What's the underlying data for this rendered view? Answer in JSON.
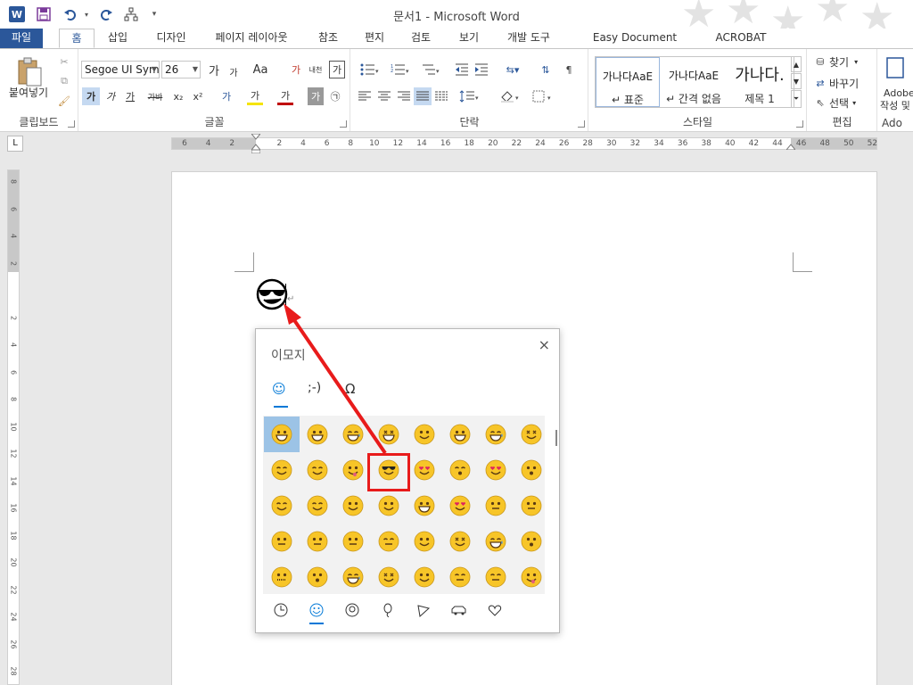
{
  "window": {
    "title": "문서1 - Microsoft Word",
    "app_icon": "W"
  },
  "quick_access": {
    "icons": [
      "save-icon",
      "undo-icon",
      "redo-icon",
      "tree-icon",
      "customize-icon"
    ]
  },
  "tabs": [
    {
      "label": "파일"
    },
    {
      "label": "홈"
    },
    {
      "label": "삽입"
    },
    {
      "label": "디자인"
    },
    {
      "label": "페이지 레이아웃"
    },
    {
      "label": "참조"
    },
    {
      "label": "편지"
    },
    {
      "label": "검토"
    },
    {
      "label": "보기"
    },
    {
      "label": "개발 도구"
    },
    {
      "label": "Easy Document Creator"
    },
    {
      "label": "ACROBAT"
    }
  ],
  "ribbon": {
    "clipboard": {
      "label": "클립보드",
      "paste_label": "붙여넣기"
    },
    "font": {
      "label": "글꼴",
      "font_name": "Segoe UI Sym",
      "font_size": "26",
      "row1": [
        "가",
        "가",
        "Aa",
        "가",
        "내천",
        "가"
      ],
      "row2": [
        "가",
        "가",
        "가",
        "가바",
        "x₂",
        "x²",
        "가",
        "가",
        "가",
        "가",
        "㉠"
      ]
    },
    "paragraph": {
      "label": "단락"
    },
    "styles": {
      "label": "스타일",
      "items": [
        {
          "sample": "가나다AaE",
          "name": "↵ 표준"
        },
        {
          "sample": "가나다AaE",
          "name": "↵ 간격 없음"
        },
        {
          "sample": "가나다.",
          "name": "제목 1"
        }
      ]
    },
    "editing": {
      "label": "편집",
      "find": "찾기",
      "replace": "바꾸기",
      "select": "선택"
    },
    "adobe": {
      "line1": "Adobe",
      "line2": "작성 및",
      "label": "Ado"
    }
  },
  "ruler": {
    "ticks": [
      "6",
      "4",
      "2",
      "",
      "2",
      "4",
      "6",
      "8",
      "10",
      "12",
      "14",
      "16",
      "18",
      "20",
      "22",
      "24",
      "26",
      "28",
      "30",
      "32",
      "34",
      "36",
      "38",
      "40",
      "42",
      "44",
      "46",
      "48",
      "50",
      "52"
    ]
  },
  "vruler": {
    "ticks": [
      "8",
      "6",
      "4",
      "2",
      "",
      "2",
      "4",
      "6",
      "8",
      "10",
      "12",
      "14",
      "16",
      "18",
      "20",
      "22",
      "24",
      "26",
      "28"
    ]
  },
  "document": {
    "inserted_emoji": "smiling-face-with-sunglasses",
    "paragraph_mark": "↵"
  },
  "emoji_panel": {
    "title": "이모지",
    "close": "×",
    "tabs": [
      {
        "label": "☺"
      },
      {
        "label": ";-)"
      },
      {
        "label": "Ω"
      }
    ],
    "selected_emoji": "smiling-face-with-sunglasses",
    "categories": [
      "recent-icon",
      "smiley-icon",
      "people-icon",
      "celebration-icon",
      "food-icon",
      "travel-icon",
      "heart-icon"
    ]
  },
  "annotation": {
    "color": "#e81b1b"
  },
  "colors": {
    "brand": "#2b579a",
    "accent": "#0078d7",
    "emoji_yellow": "#f7c528"
  }
}
